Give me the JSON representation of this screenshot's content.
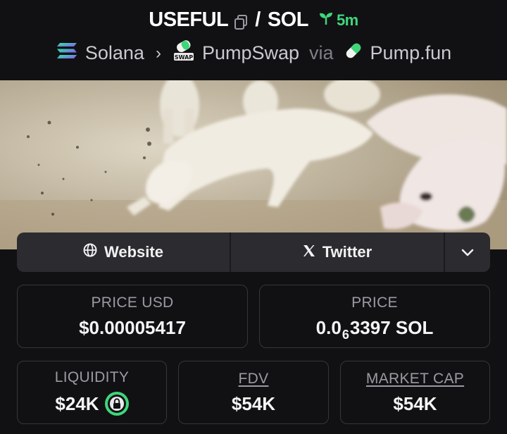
{
  "header": {
    "token_symbol": "USEFUL",
    "separator": "/",
    "quote_symbol": "SOL",
    "age": "5m",
    "chain": "Solana",
    "dex": "PumpSwap",
    "via_label": "via",
    "launchpad": "Pump.fun"
  },
  "links": {
    "website_label": "Website",
    "twitter_label": "Twitter"
  },
  "stats": {
    "price_usd_label": "PRICE USD",
    "price_usd_value": "$0.00005417",
    "price_label": "PRICE",
    "price_prefix": "0.0",
    "price_zero_count": "6",
    "price_suffix": "3397 SOL",
    "liquidity_label": "LIQUIDITY",
    "liquidity_value": "$24K",
    "fdv_label": "FDV",
    "fdv_value": "$54K",
    "market_cap_label": "MARKET CAP",
    "market_cap_value": "$54K"
  },
  "icons": {
    "copy": "copy-icon",
    "age": "sprout-icon",
    "chain": "solana-icon",
    "dex": "pumpswap-icon",
    "launchpad": "pill-icon",
    "website": "globe-icon",
    "twitter": "x-icon",
    "more": "chevron-down-icon",
    "liquidity_lock": "lock-icon"
  },
  "colors": {
    "background": "#111114",
    "accent_green": "#3fd67a",
    "card_border": "#36363b",
    "button_bg": "#2c2c30"
  }
}
